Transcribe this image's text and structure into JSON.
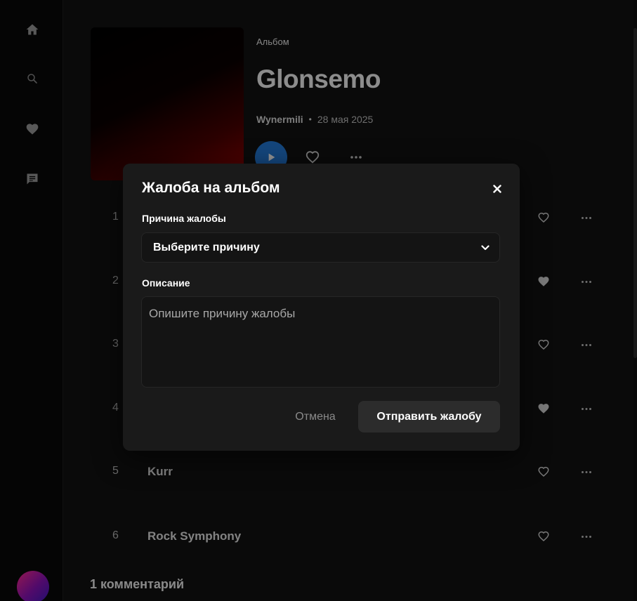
{
  "sidebar": {
    "icons": [
      "home-icon",
      "search-icon",
      "heart-icon",
      "chat-icon"
    ]
  },
  "album": {
    "type_label": "Альбом",
    "title": "Glonsemo",
    "artist": "Wynermili",
    "separator": "•",
    "date": "28 мая 2025"
  },
  "tracks": [
    {
      "num": "1",
      "title": "",
      "liked": false
    },
    {
      "num": "2",
      "title": "",
      "liked": true
    },
    {
      "num": "3",
      "title": "",
      "liked": false
    },
    {
      "num": "4",
      "title": "",
      "liked": true
    },
    {
      "num": "5",
      "title": "Kurr",
      "liked": false
    },
    {
      "num": "6",
      "title": "Rock Symphony",
      "liked": false
    }
  ],
  "comments": {
    "title": "1 комментарий"
  },
  "modal": {
    "title": "Жалоба на альбом",
    "reason_label": "Причина жалобы",
    "reason_value": "Выберите причину",
    "description_label": "Описание",
    "description_placeholder": "Опишите причину жалобы",
    "cancel_label": "Отмена",
    "submit_label": "Отправить жалобу"
  },
  "colors": {
    "accent": "#2379d6",
    "background": "#121212",
    "modal_bg": "#1a1a1a"
  }
}
